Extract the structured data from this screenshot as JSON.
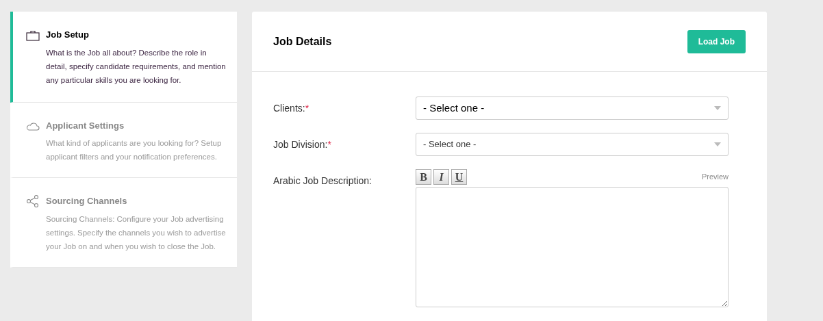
{
  "steps": [
    {
      "title": "Job Setup",
      "description": "What is the Job all about? Describe the role in detail, specify candidate requirements, and mention any particular skills you are looking for.",
      "selected": true
    },
    {
      "title": "Applicant Settings",
      "description": "What kind of applicants are you looking for? Setup applicant filters and your notification preferences.",
      "selected": false
    },
    {
      "title": "Sourcing Channels",
      "description": "Sourcing Channels: Configure your Job advertising settings. Specify the channels you wish to advertise your Job on and when you wish to close the Job.",
      "selected": false
    }
  ],
  "panel": {
    "title": "Job Details",
    "load_button": "Load Job"
  },
  "fields": [
    {
      "kind": "select",
      "label": "Clients:",
      "required_mark": "*",
      "value": "- Select one -"
    },
    {
      "kind": "select",
      "label": "Job Division:",
      "required_mark": "*",
      "value": "- Select one -"
    },
    {
      "kind": "editor",
      "label": "Arabic Job Description:",
      "toolbar": [
        "B",
        "I",
        "U"
      ],
      "preview": "Preview"
    }
  ]
}
